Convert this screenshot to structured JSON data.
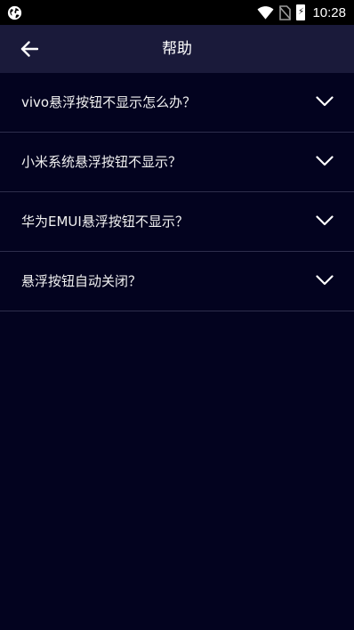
{
  "status_bar": {
    "time": "10:28",
    "battery_glyph": "⚡",
    "icons": [
      "globe-icon",
      "wifi-icon",
      "no-sim-icon",
      "battery-charging-icon"
    ]
  },
  "app_bar": {
    "title": "帮助",
    "back_icon": "back-arrow-icon"
  },
  "faq": {
    "items": [
      {
        "label": "vivo悬浮按钮不显示怎么办？"
      },
      {
        "label": "小米系统悬浮按钮不显示？"
      },
      {
        "label": "华为EMUI悬浮按钮不显示？"
      },
      {
        "label": "悬浮按钮自动关闭？"
      }
    ],
    "expand_icon": "chevron-down-icon"
  },
  "colors": {
    "background": "#03031f",
    "app_bar": "#1a1a3a",
    "divider": "#2e2e4c",
    "text": "#f2f2f2"
  }
}
